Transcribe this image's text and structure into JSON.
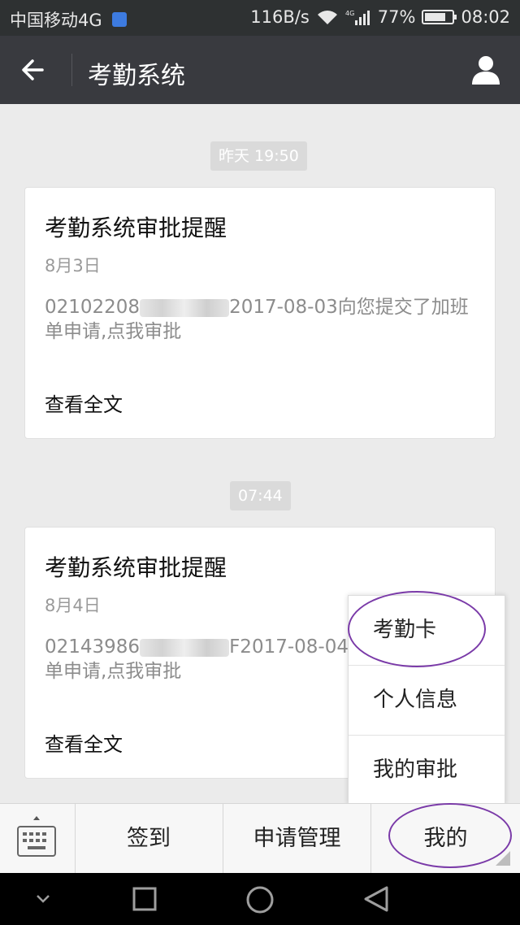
{
  "status_bar": {
    "carrier": "中国移动4G",
    "speed": "116B/s",
    "network": "4G",
    "battery": "77%",
    "battery_level": 0.77,
    "time": "08:02"
  },
  "header": {
    "title": "考勤系统"
  },
  "messages": [
    {
      "time": "昨天 19:50",
      "title": "考勤系统审批提醒",
      "date": "8月3日",
      "body_prefix": "02102208",
      "body_suffix": "2017-08-03向您提交了加班",
      "body_line2": "单申请,点我审批",
      "link": "查看全文"
    },
    {
      "time": "07:44",
      "title": "考勤系统审批提醒",
      "date": "8月4日",
      "body_prefix": "02143986",
      "body_suffix": "F2017-08-04向",
      "body_line2": "单申请,点我审批",
      "link": "查看全文"
    }
  ],
  "popup_menu": {
    "items": [
      "考勤卡",
      "个人信息",
      "我的审批"
    ]
  },
  "bottom_menu": {
    "items": [
      "签到",
      "申请管理",
      "我的"
    ]
  },
  "colors": {
    "accent_ring": "#7a3aa8",
    "titlebar": "#393a3f",
    "background": "#ebebeb"
  }
}
